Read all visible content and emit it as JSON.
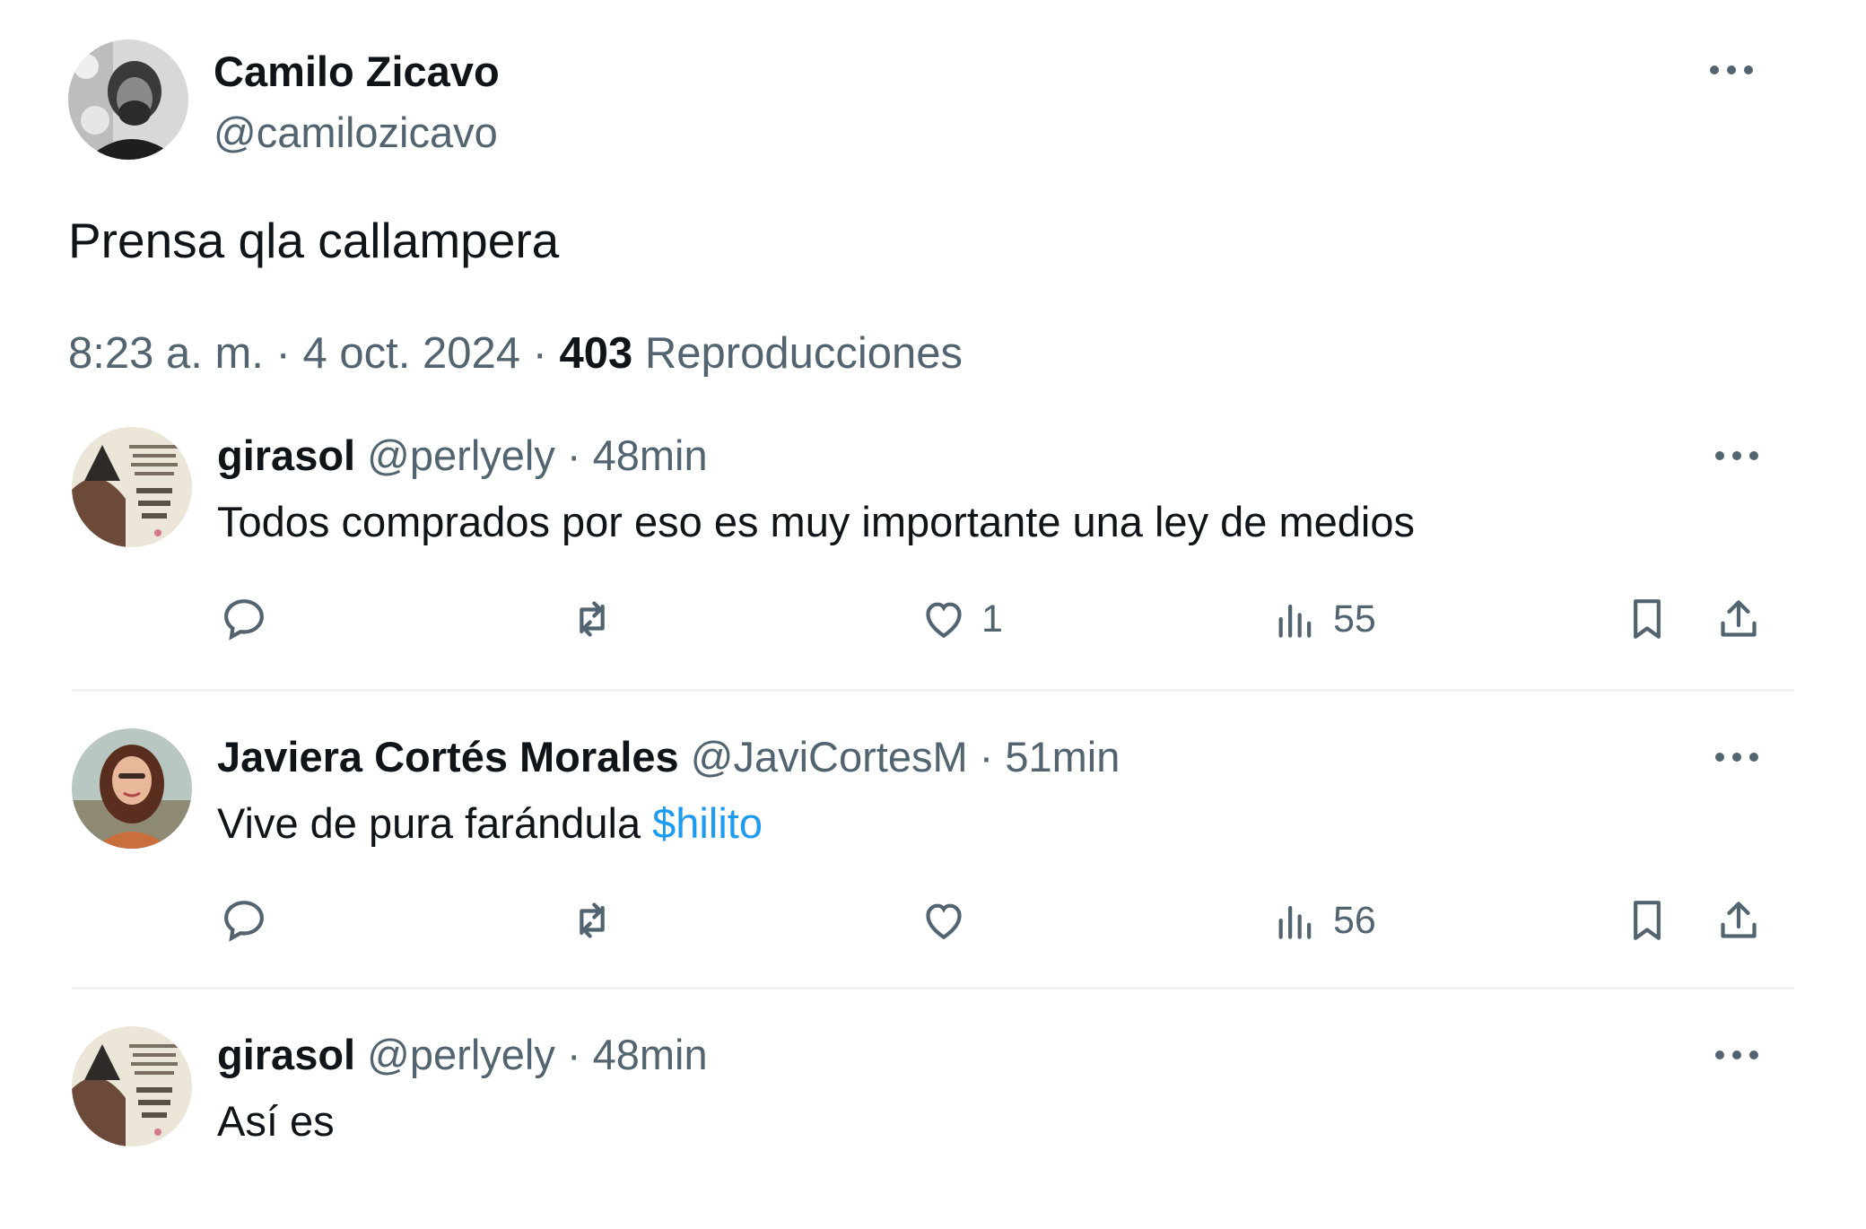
{
  "tweet": {
    "author_name": "Camilo Zicavo",
    "author_handle": "@camilozicavo",
    "text": "Prensa qla callampera",
    "time": "8:23 a. m.",
    "date": "4 oct. 2024",
    "separator": "·",
    "views_count": "403",
    "views_label": "Reproducciones"
  },
  "replies": [
    {
      "name": "girasol",
      "handle": "@perlyely",
      "time": "· 48min",
      "text": "Todos comprados por eso es muy importante una ley de medios",
      "link": "",
      "likes": "1",
      "views": "55"
    },
    {
      "name": "Javiera Cortés Morales",
      "handle": "@JaviCortesM",
      "time": "· 51min",
      "text": "Vive de pura farándula ",
      "link": "$hilito",
      "likes": "",
      "views": "56"
    },
    {
      "name": "girasol",
      "handle": "@perlyely",
      "time": "· 48min",
      "text": "Así es",
      "link": ""
    }
  ],
  "colors": {
    "text": "#0f1419",
    "secondary": "#536471",
    "link": "#1d9bf0",
    "divider": "#eff3f4"
  },
  "icons": [
    "more-icon",
    "reply-icon",
    "retweet-icon",
    "like-icon",
    "views-icon",
    "bookmark-icon",
    "share-icon"
  ]
}
